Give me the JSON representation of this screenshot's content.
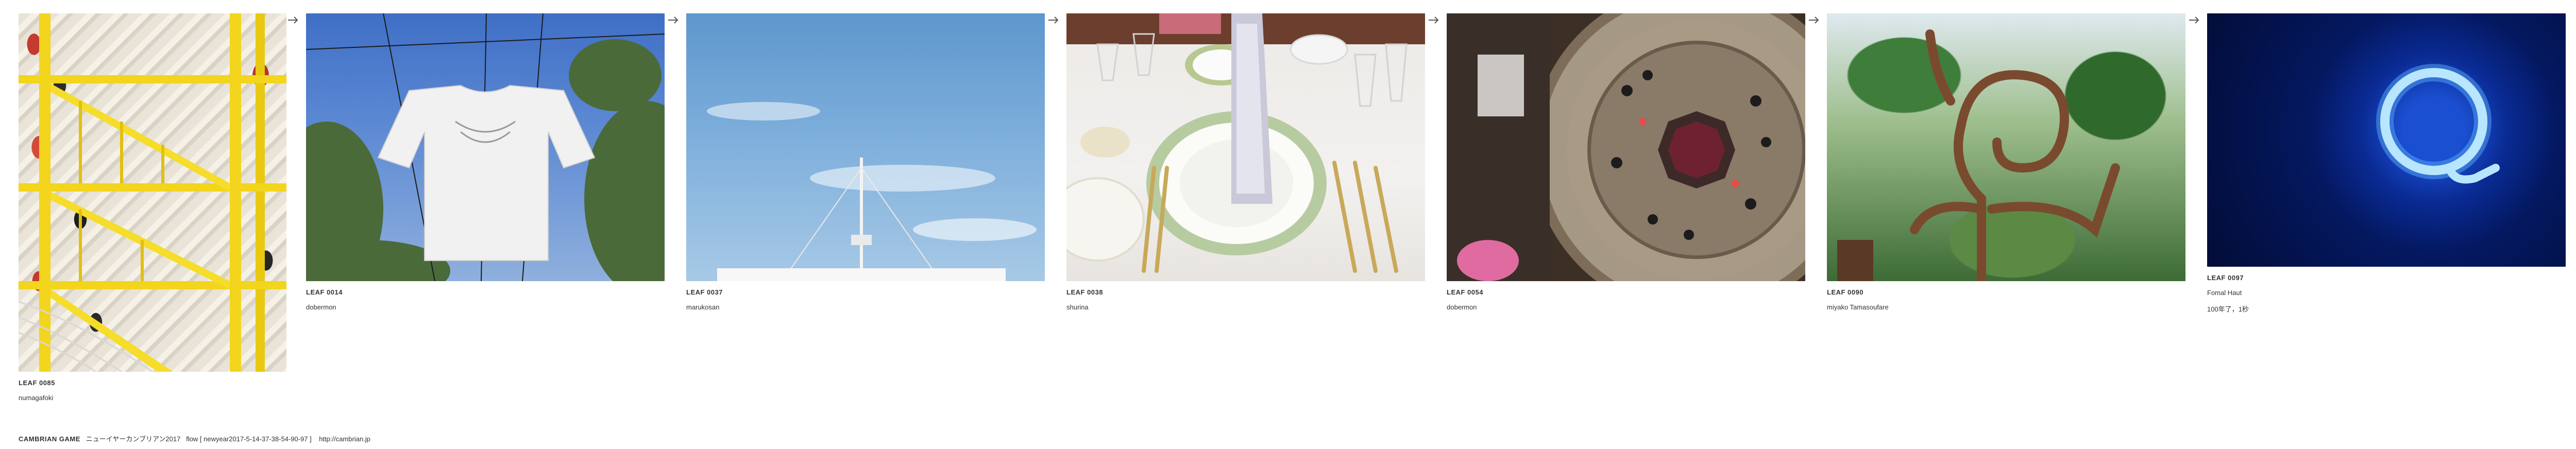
{
  "leaves": [
    {
      "code": "LEAF 0085",
      "author": "numagafoki",
      "scene": "yellow staircase mural"
    },
    {
      "code": "LEAF 0014",
      "author": "dobermon",
      "scene": "shirt on wires in sky"
    },
    {
      "code": "LEAF 0037",
      "author": "marukosan",
      "scene": "ship mast and sky"
    },
    {
      "code": "LEAF 0038",
      "author": "shurina",
      "scene": "dinner table setting"
    },
    {
      "code": "LEAF 0054",
      "author": "dobermon",
      "scene": "circular well from above"
    },
    {
      "code": "LEAF 0090",
      "author": "miyako Tamasoufare",
      "scene": "twisted tree sculpture"
    },
    {
      "code": "LEAF 0097",
      "author": "Fomal Haut",
      "note": "100年了，1秒",
      "scene": "blue neon ring"
    }
  ],
  "arrow_icon": "right-arrow-icon",
  "footer": {
    "brand": "CAMBRIAN GAME",
    "title": "ニューイヤーカンブリアン2017",
    "flow": "flow [ newyear2017-5-14-37-38-54-90-97 ]",
    "url": "http://cambrian.jp"
  },
  "colors": {
    "background": "#ffffff",
    "text": "#333333",
    "arrow": "#555555"
  }
}
